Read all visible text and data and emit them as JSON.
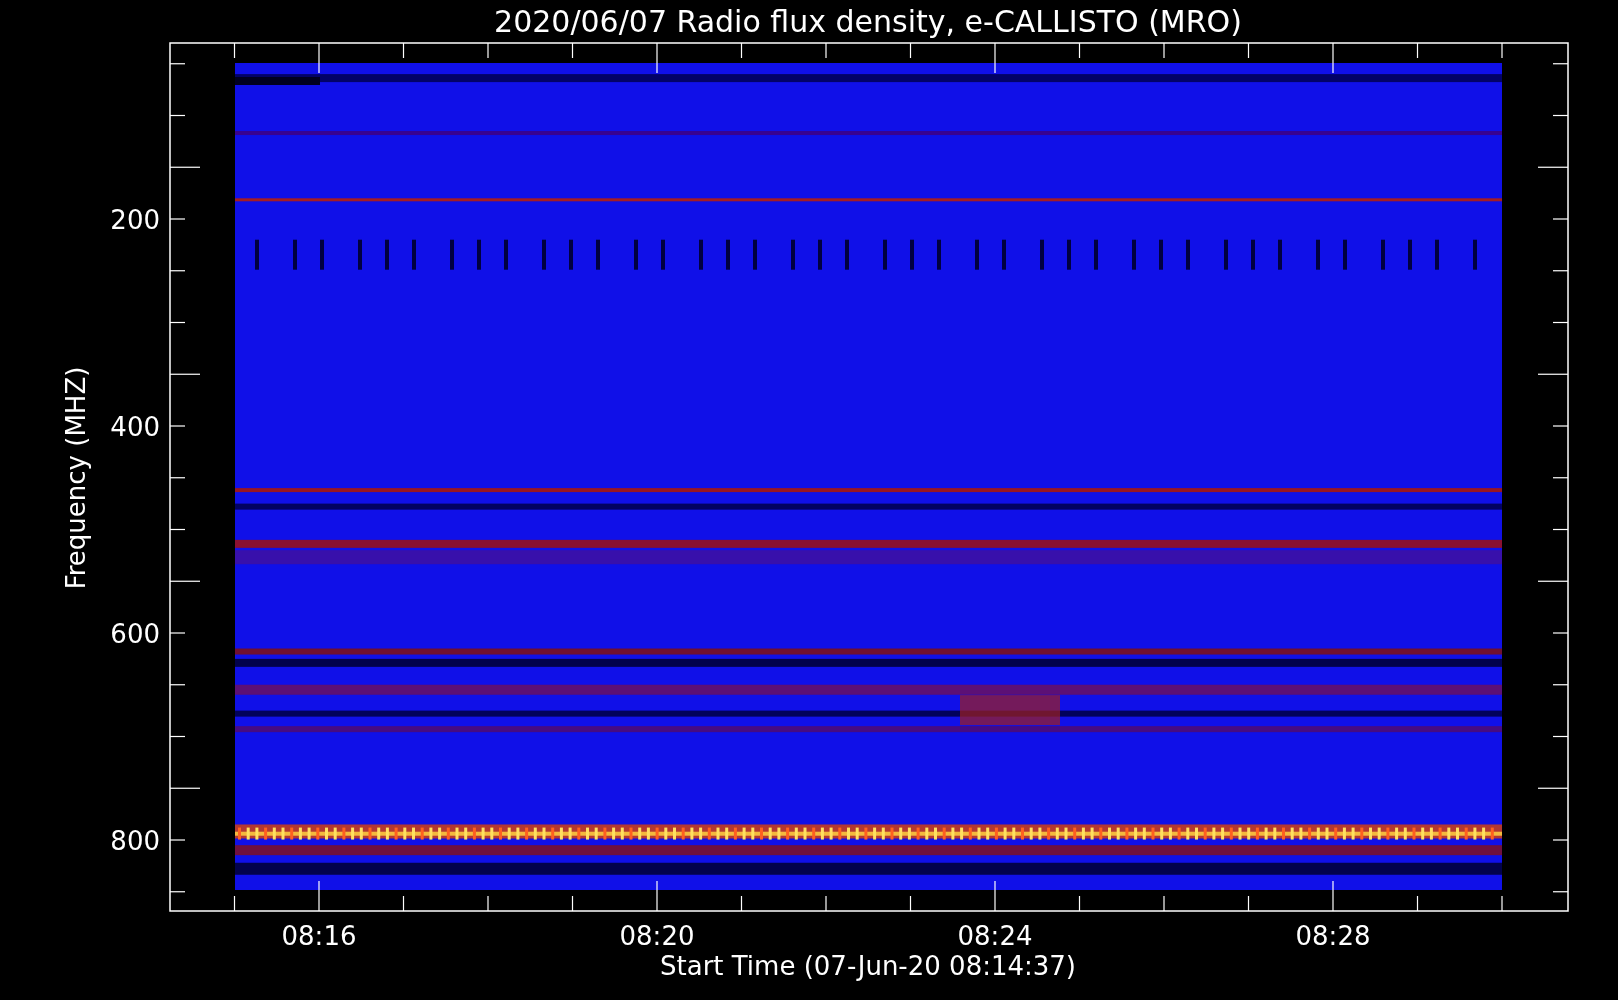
{
  "chart": {
    "title": "2020/06/07  Radio flux density, e-CALLISTO (MRO)",
    "xlabel": "Start Time (07-Jun-20 08:14:37)",
    "ylabel": "Frequency (MHZ)",
    "yticks": [
      "200",
      "400",
      "600",
      "800"
    ],
    "xticks": [
      "08:16",
      "08:20",
      "08:24",
      "08:28"
    ]
  }
}
